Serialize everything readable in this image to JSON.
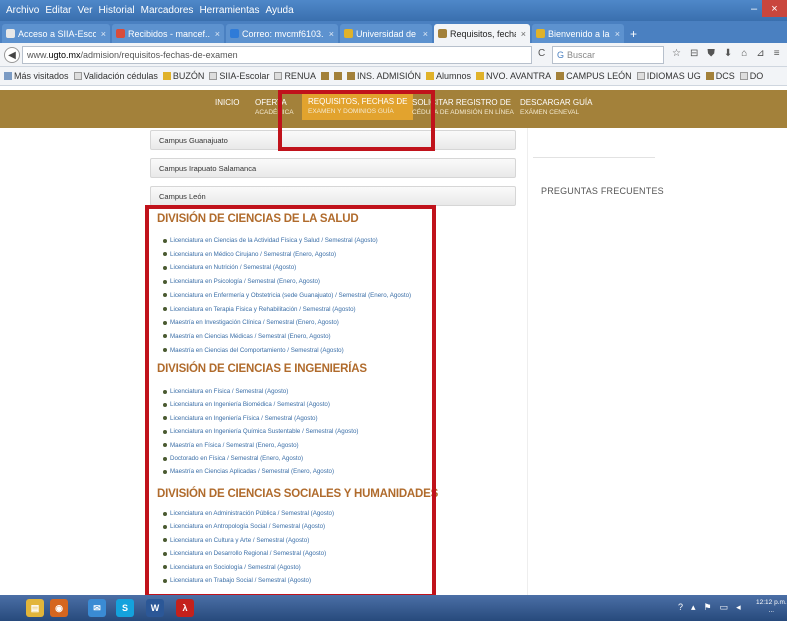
{
  "window": {
    "menu": [
      "Archivo",
      "Editar",
      "Ver",
      "Historial",
      "Marcadores",
      "Herramientas",
      "Ayuda"
    ],
    "minimize_glyph": "–",
    "close_glyph": "×"
  },
  "tabs": [
    {
      "label": "Acceso a SIIA-Escolar",
      "icon_color": "#e8e8e8"
    },
    {
      "label": "Recibidos - mancef...",
      "icon_color": "#d94c3a"
    },
    {
      "label": "Correo: mvcmf6103...",
      "icon_color": "#2f7bd8"
    },
    {
      "label": "Universidad de Gu...",
      "icon_color": "#e0b22a"
    },
    {
      "label": "Requisitos, fechas de",
      "icon_color": "#a3813a",
      "active": true
    },
    {
      "label": "Bienvenido a la Dir...",
      "icon_color": "#e0b22a"
    }
  ],
  "tab_close_glyph": "×",
  "newtab_glyph": "+",
  "nav": {
    "back_glyph": "◀",
    "url_prefix": "www.",
    "url_domain": "ugto.mx",
    "url_path": "/admision/requisitos-fechas-de-examen",
    "reload_glyph": "C",
    "search_placeholder": "Buscar",
    "toolbar_icons": [
      "☆",
      "⊟",
      "⛊",
      "⬇",
      "⌂",
      "⊿",
      "≡"
    ]
  },
  "bookmarks": [
    {
      "label": "Más visitados",
      "icon": "folder",
      "color": "#7b9bc4"
    },
    {
      "label": "Validación cédulas",
      "icon": "page",
      "color": "#dddddd"
    },
    {
      "label": "BUZÓN",
      "icon": "bookmark",
      "color": "#e0b22a"
    },
    {
      "label": "SIIA-Escolar",
      "icon": "page",
      "color": "#dddddd"
    },
    {
      "label": "RENUA",
      "icon": "page",
      "color": "#dddddd"
    },
    {
      "label": "",
      "icon": "bookmark",
      "color": "#a3813a"
    },
    {
      "label": "",
      "icon": "bookmark",
      "color": "#a3813a"
    },
    {
      "label": "INS. ADMISIÓN",
      "icon": "bookmark",
      "color": "#a3813a"
    },
    {
      "label": "Alumnos",
      "icon": "bookmark",
      "color": "#e0b22a"
    },
    {
      "label": "NVO. AVANTRA",
      "icon": "bookmark",
      "color": "#e0b22a"
    },
    {
      "label": "CAMPUS LEÓN",
      "icon": "bookmark",
      "color": "#a3813a"
    },
    {
      "label": "IDIOMAS UG",
      "icon": "page",
      "color": "#dddddd"
    },
    {
      "label": "DCS",
      "icon": "bookmark",
      "color": "#a3813a"
    },
    {
      "label": "DO",
      "icon": "page",
      "color": "#dddddd"
    }
  ],
  "site_nav": [
    {
      "label": "INICIO",
      "sub": ""
    },
    {
      "label": "OFERTA",
      "sub": "ACADÉMICA"
    },
    {
      "label": "REQUISITOS, FECHAS DE",
      "sub": "EXAMEN Y DOMINIOS GUÍA",
      "active": true
    },
    {
      "label": "SOLICITAR REGISTRO DE",
      "sub": "CÉDULA DE ADMISIÓN EN LÍNEA"
    },
    {
      "label": "DESCARGAR GUÍA",
      "sub": "EXÁMEN CENEVAL"
    }
  ],
  "accordion": [
    "Campus Guanajuato",
    "Campus Irapuato Salamanca",
    "Campus León"
  ],
  "sidebar": {
    "faq": "PREGUNTAS FRECUENTES"
  },
  "divisions": [
    {
      "title": "DIVISIÓN DE CIENCIAS DE LA SALUD",
      "programs": [
        "Licenciatura en Ciencias de la Actividad Física y Salud / Semestral (Agosto)",
        "Licenciatura en Médico Cirujano / Semestral (Enero, Agosto)",
        "Licenciatura en Nutrición / Semestral (Agosto)",
        "Licenciatura en Psicología / Semestral (Enero, Agosto)",
        "Licenciatura en Enfermería y Obstetricia (sede Guanajuato) / Semestral (Enero, Agosto)",
        "Licenciatura en Terapia Física y Rehabilitación / Semestral (Agosto)",
        "Maestría en Investigación Clínica / Semestral (Enero, Agosto)",
        "Maestría en Ciencias Médicas / Semestral (Enero, Agosto)",
        "Maestría en Ciencias del Comportamiento / Semestral (Agosto)"
      ]
    },
    {
      "title": "DIVISIÓN DE CIENCIAS E INGENIERÍAS",
      "programs": [
        "Licenciatura en Física / Semestral (Agosto)",
        "Licenciatura en Ingeniería Biomédica / Semestral (Agosto)",
        "Licenciatura en Ingeniería Física / Semestral (Agosto)",
        "Licenciatura en Ingeniería Química Sustentable / Semestral (Agosto)",
        "Maestría en Física / Semestral (Enero, Agosto)",
        "Doctorado en Física / Semestral (Enero, Agosto)",
        "Maestría en Ciencias Aplicadas / Semestral (Enero, Agosto)"
      ]
    },
    {
      "title": "DIVISIÓN DE CIENCIAS SOCIALES Y HUMANIDADES",
      "programs": [
        "Licenciatura en Administración Pública / Semestral (Agosto)",
        "Licenciatura en Antropología Social / Semestral (Agosto)",
        "Licenciatura en Cultura y Arte / Semestral (Agosto)",
        "Licenciatura en Desarrollo Regional / Semestral (Agosto)",
        "Licenciatura en Sociología / Semestral (Agosto)",
        "Licenciatura en Trabajo Social / Semestral (Agosto)"
      ]
    }
  ],
  "taskbar": {
    "apps": [
      {
        "name": "file-explorer",
        "glyph": "▤",
        "color": "#e2b53a"
      },
      {
        "name": "firefox",
        "glyph": "◉",
        "color": "#d5661f"
      },
      {
        "name": "mail",
        "glyph": "✉",
        "color": "#3a8bd4"
      },
      {
        "name": "skype",
        "glyph": "S",
        "color": "#14a2dd"
      },
      {
        "name": "word",
        "glyph": "W",
        "color": "#2b5797"
      },
      {
        "name": "acrobat",
        "glyph": "λ",
        "color": "#c4211c"
      }
    ],
    "tray_icons": [
      "?",
      "▴",
      "⚑",
      "▭",
      "◂"
    ],
    "time": "12:12 p.m.",
    "date": "..."
  }
}
